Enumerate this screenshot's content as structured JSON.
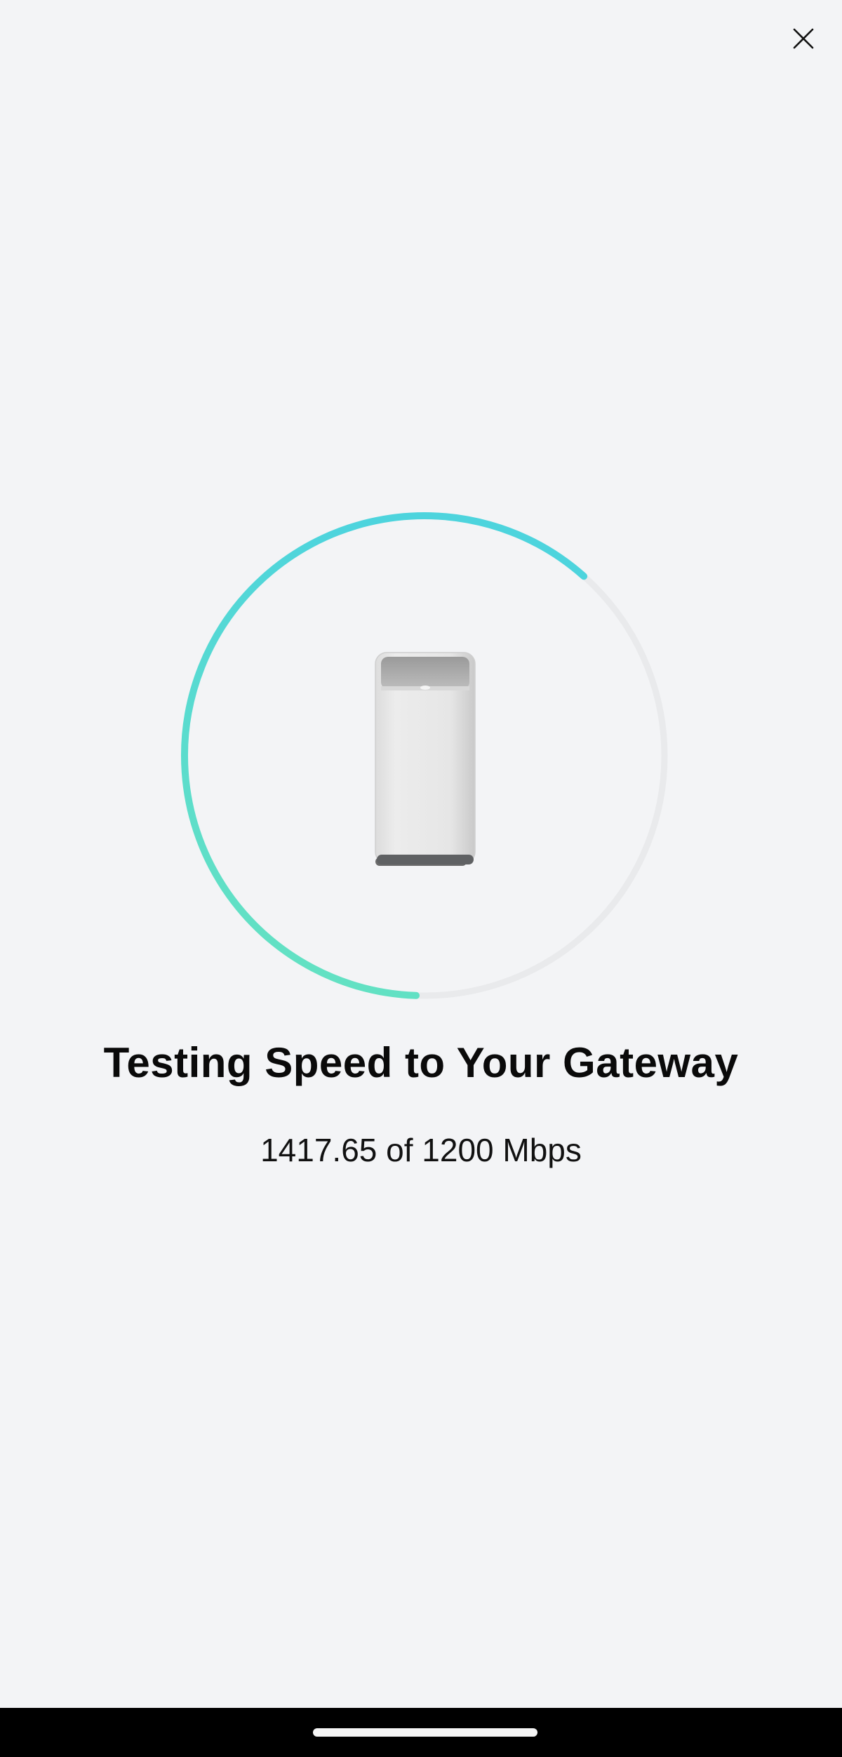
{
  "header": {
    "close_icon": "close-icon"
  },
  "progress": {
    "fraction": 0.61,
    "colors": {
      "start": "#66e3bf",
      "end": "#4dd4dd",
      "track": "#e9eaec"
    }
  },
  "device": {
    "icon": "gateway-device-image"
  },
  "main": {
    "title": "Testing Speed to Your Gateway",
    "speed_text": "1417.65 of 1200 Mbps"
  },
  "system": {
    "nav_bar_color": "#000000"
  }
}
